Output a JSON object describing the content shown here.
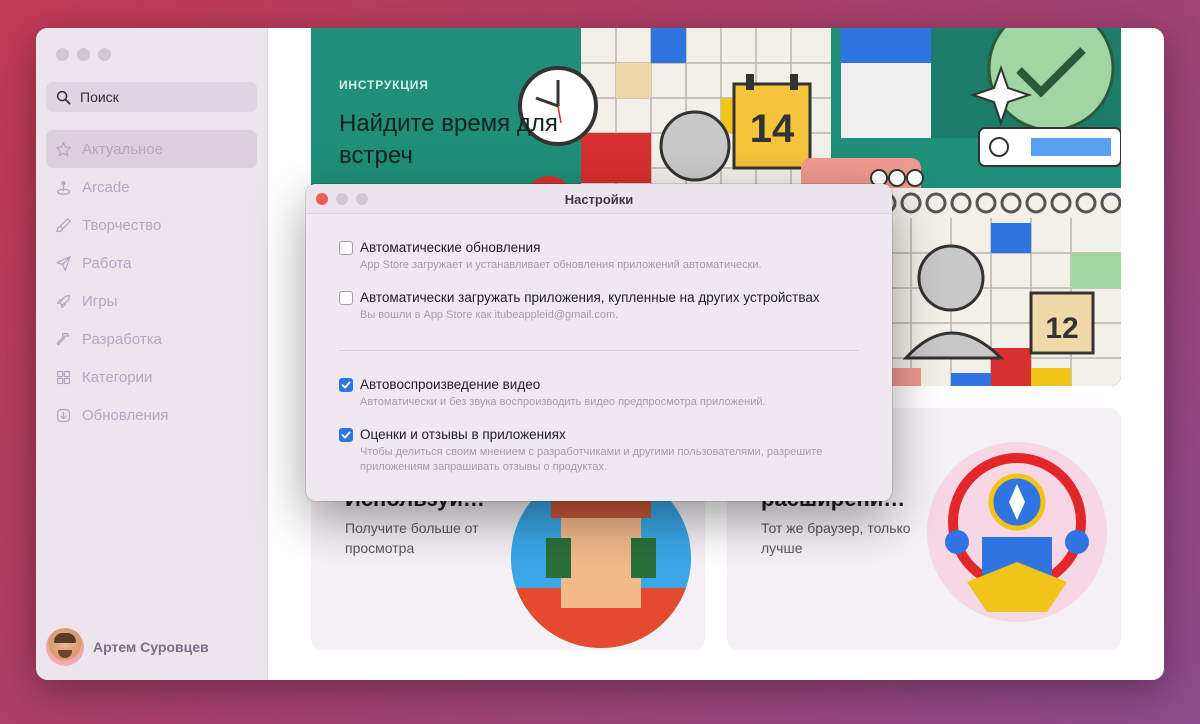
{
  "sidebar": {
    "search_placeholder": "Поиск",
    "items": [
      {
        "label": "Актуальное",
        "icon": "star-icon",
        "active": true
      },
      {
        "label": "Arcade",
        "icon": "joystick-icon"
      },
      {
        "label": "Творчество",
        "icon": "brush-icon"
      },
      {
        "label": "Работа",
        "icon": "paper-plane-icon"
      },
      {
        "label": "Игры",
        "icon": "rocket-icon"
      },
      {
        "label": "Разработка",
        "icon": "hammer-icon"
      },
      {
        "label": "Категории",
        "icon": "grid-icon"
      },
      {
        "label": "Обновления",
        "icon": "download-icon"
      }
    ],
    "user_name": "Артем Суровцев"
  },
  "banner": {
    "kicker": "ИНСТРУКЦИЯ",
    "title": "Найдите время для встреч"
  },
  "cards": [
    {
      "title": "Используй…",
      "description": "Получите больше от просмотра"
    },
    {
      "title": "расширени…",
      "description": "Тот же браузер, только лучше"
    }
  ],
  "dialog": {
    "title": "Настройки",
    "options": [
      {
        "label": "Автоматические обновления",
        "description": "App Store загружает и устанавливает обновления приложений автоматически.",
        "checked": false
      },
      {
        "label": "Автоматически загружать приложения, купленные на других устройствах",
        "description": "Вы вошли в App Store как itubeappleid@gmail.com.",
        "checked": false
      },
      {
        "label": "Автовоспроизведение видео",
        "description": "Автоматически и без звука воспроизводить видео предпросмотра приложений.",
        "checked": true
      },
      {
        "label": "Оценки и отзывы в приложениях",
        "description": "Чтобы делиться своим мнением с разработчиками и другими пользователями, разрешите приложениям запрашивать отзывы о продуктах.",
        "checked": true
      }
    ]
  },
  "colors": {
    "accent": "#2f74e0",
    "close": "#ed5f56",
    "banner_bg": "#1f8f77"
  }
}
